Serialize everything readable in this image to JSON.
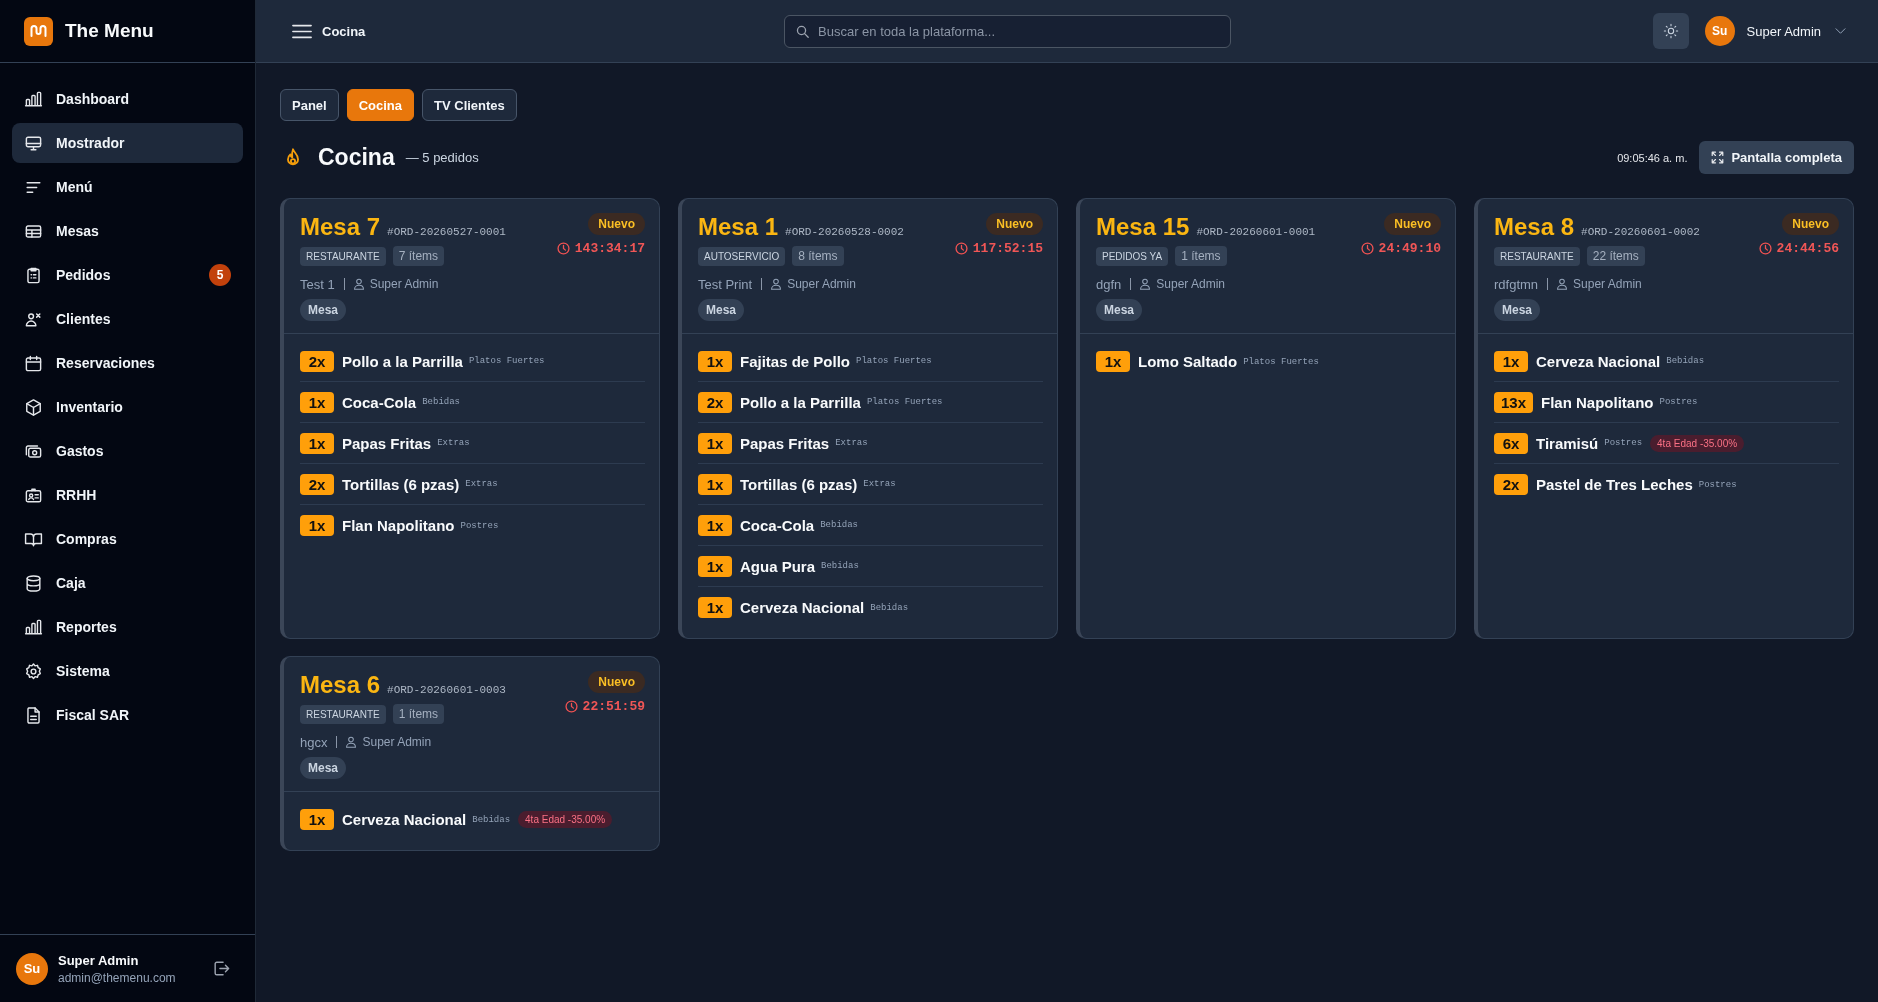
{
  "sidebar": {
    "brand": "The Menu",
    "items": [
      {
        "label": "Dashboard",
        "selected": false
      },
      {
        "label": "Mostrador",
        "selected": true
      },
      {
        "label": "Menú",
        "selected": false
      },
      {
        "label": "Mesas",
        "selected": false
      },
      {
        "label": "Pedidos",
        "selected": false,
        "badge": "5"
      },
      {
        "label": "Clientes",
        "selected": false
      },
      {
        "label": "Reservaciones",
        "selected": false
      },
      {
        "label": "Inventario",
        "selected": false
      },
      {
        "label": "Gastos",
        "selected": false
      },
      {
        "label": "RRHH",
        "selected": false
      },
      {
        "label": "Compras",
        "selected": false
      },
      {
        "label": "Caja",
        "selected": false
      },
      {
        "label": "Reportes",
        "selected": false
      },
      {
        "label": "Sistema",
        "selected": false
      },
      {
        "label": "Fiscal SAR",
        "selected": false
      }
    ],
    "user": {
      "initials": "Su",
      "name": "Super Admin",
      "email": "admin@themenu.com"
    }
  },
  "topbar": {
    "title": "Cocina",
    "search": {
      "placeholder": "Buscar en toda la plataforma..."
    },
    "user": {
      "initials": "Su",
      "name": "Super Admin"
    }
  },
  "tabs": [
    {
      "label": "Panel",
      "selected": false
    },
    {
      "label": "Cocina",
      "selected": true
    },
    {
      "label": "TV Clientes",
      "selected": false
    }
  ],
  "header": {
    "title": "Cocina",
    "subtitle": "— 5 pedidos",
    "time": "09:05:46 a. m.",
    "fullscreen_button": "Pantalla completa"
  },
  "orders": [
    {
      "table": "Mesa 7",
      "number": "#ORD-20260527-0001",
      "status": "Nuevo",
      "timer": "143:34:17",
      "channel": "RESTAURANTE",
      "item_count": "7 ítems",
      "customer": "Test 1",
      "waiter": "Super Admin",
      "service": "Mesa",
      "items": [
        {
          "qty": "2x",
          "name": "Pollo a la Parrilla",
          "category": "Platos Fuertes"
        },
        {
          "qty": "1x",
          "name": "Coca-Cola",
          "category": "Bebidas"
        },
        {
          "qty": "1x",
          "name": "Papas Fritas",
          "category": "Extras"
        },
        {
          "qty": "2x",
          "name": "Tortillas (6 pzas)",
          "category": "Extras"
        },
        {
          "qty": "1x",
          "name": "Flan Napolitano",
          "category": "Postres"
        }
      ]
    },
    {
      "table": "Mesa 1",
      "number": "#ORD-20260528-0002",
      "status": "Nuevo",
      "timer": "117:52:15",
      "channel": "AUTOSERVICIO",
      "item_count": "8 ítems",
      "customer": "Test Print",
      "waiter": "Super Admin",
      "service": "Mesa",
      "items": [
        {
          "qty": "1x",
          "name": "Fajitas de Pollo",
          "category": "Platos Fuertes"
        },
        {
          "qty": "2x",
          "name": "Pollo a la Parrilla",
          "category": "Platos Fuertes"
        },
        {
          "qty": "1x",
          "name": "Papas Fritas",
          "category": "Extras"
        },
        {
          "qty": "1x",
          "name": "Tortillas (6 pzas)",
          "category": "Extras"
        },
        {
          "qty": "1x",
          "name": "Coca-Cola",
          "category": "Bebidas"
        },
        {
          "qty": "1x",
          "name": "Agua Pura",
          "category": "Bebidas"
        },
        {
          "qty": "1x",
          "name": "Cerveza Nacional",
          "category": "Bebidas"
        }
      ]
    },
    {
      "table": "Mesa 15",
      "number": "#ORD-20260601-0001",
      "status": "Nuevo",
      "timer": "24:49:10",
      "channel": "PEDIDOS YA",
      "item_count": "1 ítems",
      "customer": "dgfn",
      "waiter": "Super Admin",
      "service": "Mesa",
      "items": [
        {
          "qty": "1x",
          "name": "Lomo Saltado",
          "category": "Platos Fuertes"
        }
      ]
    },
    {
      "table": "Mesa 8",
      "number": "#ORD-20260601-0002",
      "status": "Nuevo",
      "timer": "24:44:56",
      "channel": "RESTAURANTE",
      "item_count": "22 ítems",
      "customer": "rdfgtmn",
      "waiter": "Super Admin",
      "service": "Mesa",
      "items": [
        {
          "qty": "1x",
          "name": "Cerveza Nacional",
          "category": "Bebidas"
        },
        {
          "qty": "13x",
          "name": "Flan Napolitano",
          "category": "Postres"
        },
        {
          "qty": "6x",
          "name": "Tiramisú",
          "category": "Postres",
          "discount": "4ta Edad -35.00%"
        },
        {
          "qty": "2x",
          "name": "Pastel de Tres Leches",
          "category": "Postres"
        }
      ]
    },
    {
      "table": "Mesa 6",
      "number": "#ORD-20260601-0003",
      "status": "Nuevo",
      "timer": "22:51:59",
      "channel": "RESTAURANTE",
      "item_count": "1 ítems",
      "customer": "hgcx",
      "waiter": "Super Admin",
      "service": "Mesa",
      "items": [
        {
          "qty": "1x",
          "name": "Cerveza Nacional",
          "category": "Bebidas",
          "discount": "4ta Edad -35.00%"
        }
      ]
    }
  ]
}
